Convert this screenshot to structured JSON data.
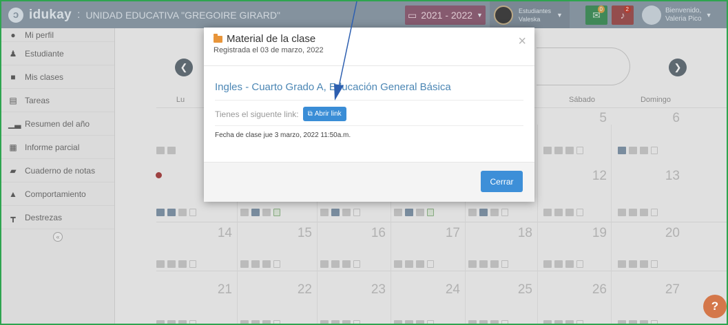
{
  "navbar": {
    "brand": "idukay",
    "separator": ":",
    "school": "UNIDAD EDUCATIVA \"GREGOIRE GIRARD\"",
    "year": "2021 - 2022",
    "student_label": "Estudiantes",
    "student_name": "Valeska",
    "messages_count": "0",
    "notifications_count": "2",
    "welcome": "Bienvenido,",
    "user_name": "Valeria Pico"
  },
  "sidebar": {
    "items": [
      {
        "label": "Mi perfil",
        "icon": "user-icon"
      },
      {
        "label": "Estudiante",
        "icon": "student-icon"
      },
      {
        "label": "Mis clases",
        "icon": "folder-icon"
      },
      {
        "label": "Tareas",
        "icon": "tasks-icon"
      },
      {
        "label": "Resumen del año",
        "icon": "bar-chart-icon"
      },
      {
        "label": "Informe parcial",
        "icon": "table-icon"
      },
      {
        "label": "Cuaderno de notas",
        "icon": "notebook-icon"
      },
      {
        "label": "Comportamiento",
        "icon": "thumbs-up-icon"
      },
      {
        "label": "Destrezas",
        "icon": "sitemap-icon"
      }
    ],
    "collapse_symbol": "«"
  },
  "calendar": {
    "day_headers": [
      "Lu",
      "Sábado",
      "Domingo"
    ],
    "week1": [
      "5",
      "6"
    ],
    "week2": [
      "12",
      "13"
    ],
    "week3": [
      "14",
      "15",
      "16",
      "17",
      "18",
      "19",
      "20"
    ],
    "week4": [
      "21",
      "22",
      "23",
      "24",
      "25",
      "26",
      "27"
    ]
  },
  "modal": {
    "title": "Material de la clase",
    "subtitle": "Registrada el 03 de marzo, 2022",
    "close_symbol": "×",
    "class_title": "Ingles - Cuarto Grado A, Educación General Básica",
    "link_text": "Tienes el siguente link:",
    "link_button": "Abrir link",
    "date_text": "Fecha de clase jue 3 marzo, 2022 11:50a.m.",
    "close_button": "Cerrar"
  },
  "help": "?",
  "colors": {
    "navbar": "#8a9aa8",
    "accent": "#3a8dd6",
    "class_title": "#4b86b4",
    "frame": "#2ea44f"
  }
}
